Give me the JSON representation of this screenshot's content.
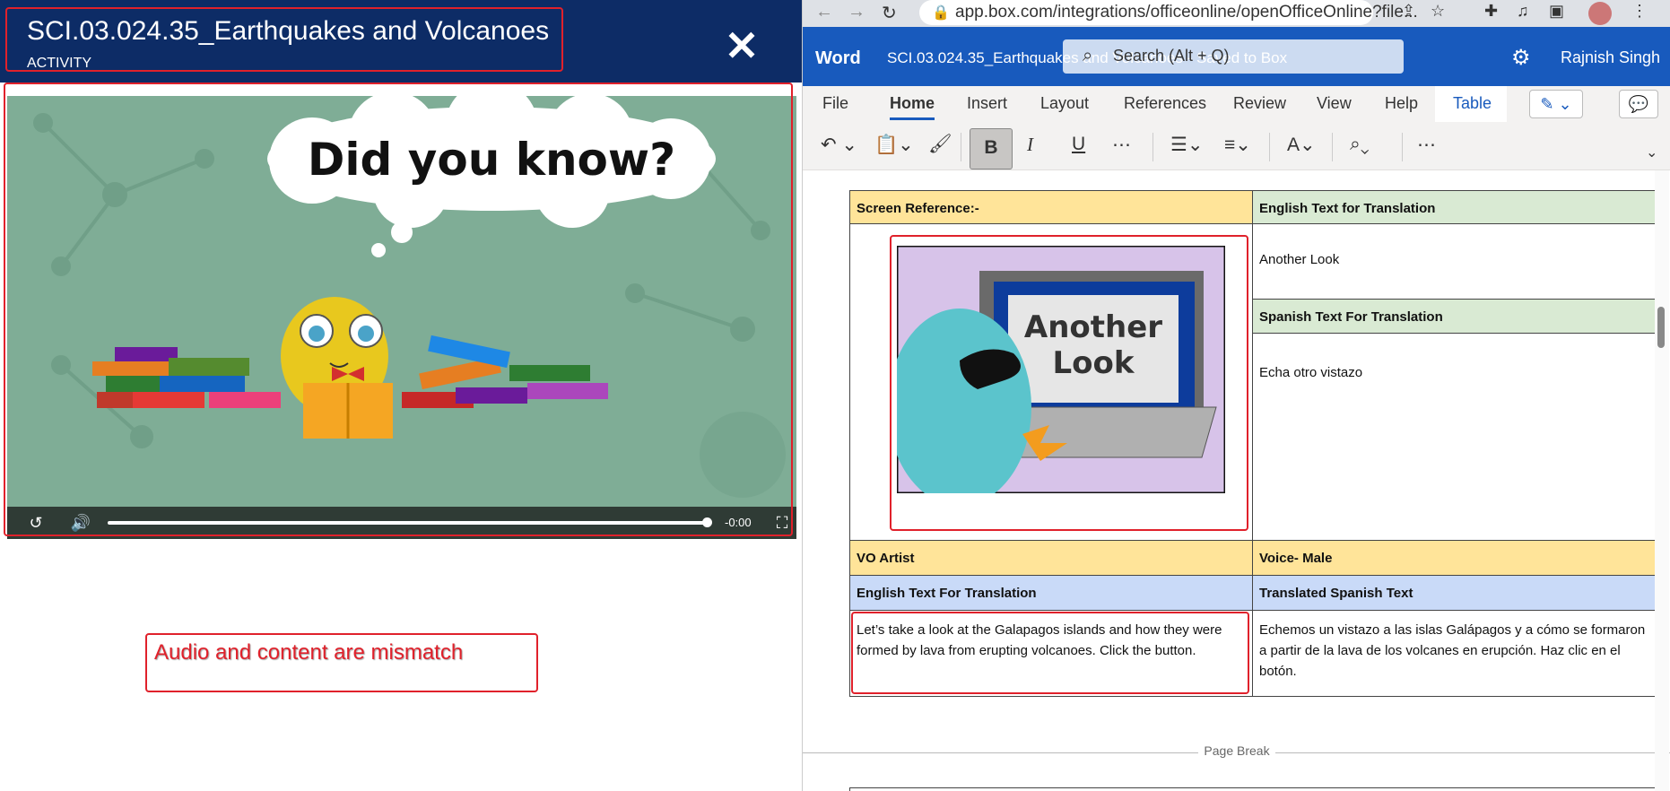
{
  "left_panel": {
    "title": "SCI.03.024.35_Earthquakes and Volcanoes",
    "subtitle": "ACTIVITY",
    "close_label": "✕",
    "video": {
      "bubble_text": "Did you know?",
      "time": "-0:00",
      "progress_fraction": 0.99
    },
    "note": "Audio and content are mismatch",
    "annotation_color": "#e0212b"
  },
  "browser": {
    "url": "app.box.com/integrations/officeonline/openOfficeOnline?file..."
  },
  "word": {
    "app_name": "Word",
    "doc_title": "SCI.03.024.35_Earthquakes and Volcanoes - Saved to Box",
    "search_placeholder": "Search (Alt + Q)",
    "user": "Rajnish Singh",
    "menu": [
      "File",
      "Home",
      "Insert",
      "Layout",
      "References",
      "Review",
      "View",
      "Help",
      "Table"
    ],
    "active_tab": "Home",
    "accent": "#185abd"
  },
  "table": {
    "screen_ref_label": "Screen Reference:-",
    "english_text_label": "English Text for Translation",
    "english_value": "Another Look",
    "spanish_label": "Spanish Text For Translation",
    "spanish_value": "Echa otro vistazo",
    "image_text_line1": "Another",
    "image_text_line2": "Look",
    "vo_artist_label": "VO Artist",
    "voice_label": "Voice- Male",
    "english_translation_label": "English Text For Translation",
    "translated_label": "Translated Spanish Text",
    "english_paragraph": "Let’s take a look at the Galapagos islands and how they were formed by lava from erupting volcanoes. Click the button.",
    "spanish_paragraph": "Echemos un vistazo a las islas Galápagos y a cómo se formaron a partir de la lava de los volcanes en erupción. Haz clic en el botón.",
    "page_break": "Page Break"
  }
}
